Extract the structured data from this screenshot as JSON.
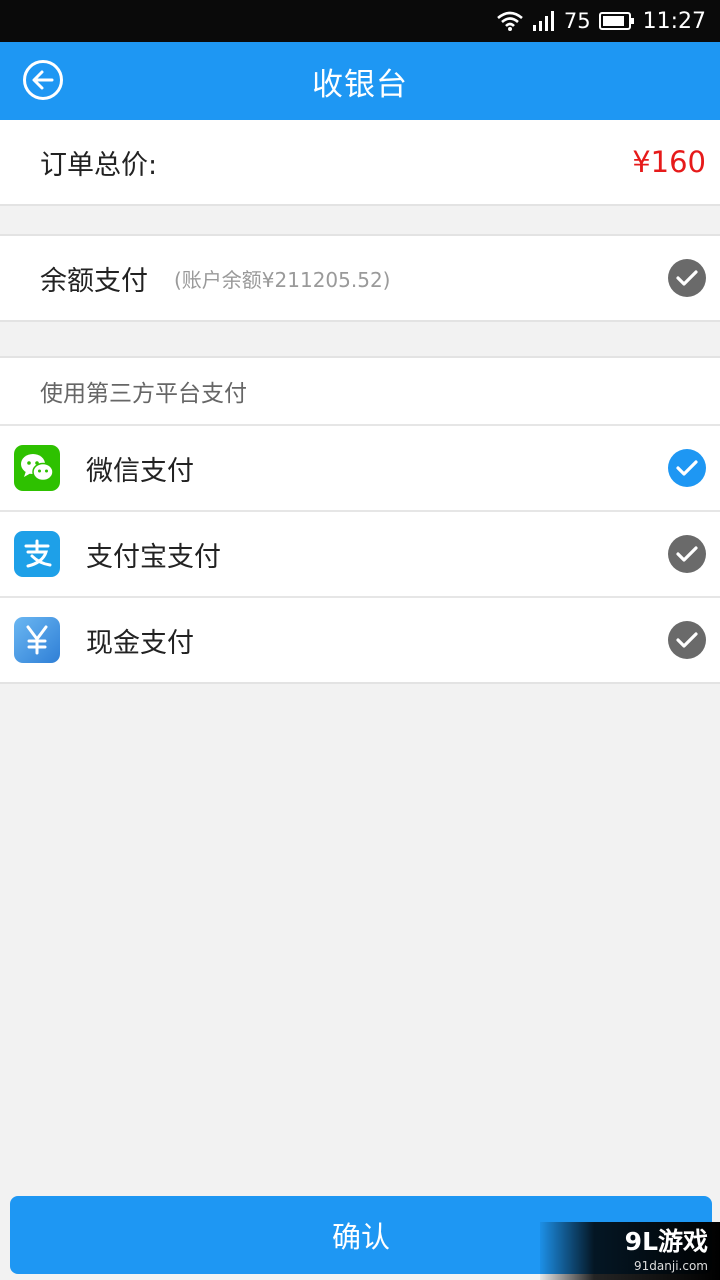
{
  "status_bar": {
    "battery_level": "75",
    "time": "11:27",
    "icons": [
      "wifi-icon",
      "signal-icon",
      "battery-icon"
    ]
  },
  "header": {
    "title": "收银台",
    "back_icon": "back-arrow-circle-icon"
  },
  "order": {
    "total_label": "订单总价:",
    "total_value": "¥160"
  },
  "balance": {
    "label": "余额支付",
    "note": "(账户余额¥211205.52)",
    "selected": false
  },
  "third_party": {
    "header": "使用第三方平台支付",
    "options": [
      {
        "label": "微信支付",
        "icon": "wechat-icon",
        "selected": true
      },
      {
        "label": "支付宝支付",
        "icon": "alipay-icon",
        "selected": false
      },
      {
        "label": "现金支付",
        "icon": "cash-yen-icon",
        "selected": false
      }
    ]
  },
  "confirm": {
    "label": "确认"
  },
  "watermark": {
    "main": "9L游戏",
    "sub": "91danji.com"
  },
  "colors": {
    "accent": "#1e97f3",
    "price": "#e61a1a",
    "check_unselected": "#6a6a6a",
    "wechat": "#2ec100",
    "alipay": "#1ea0e8",
    "cash": "#3f8fe0"
  }
}
